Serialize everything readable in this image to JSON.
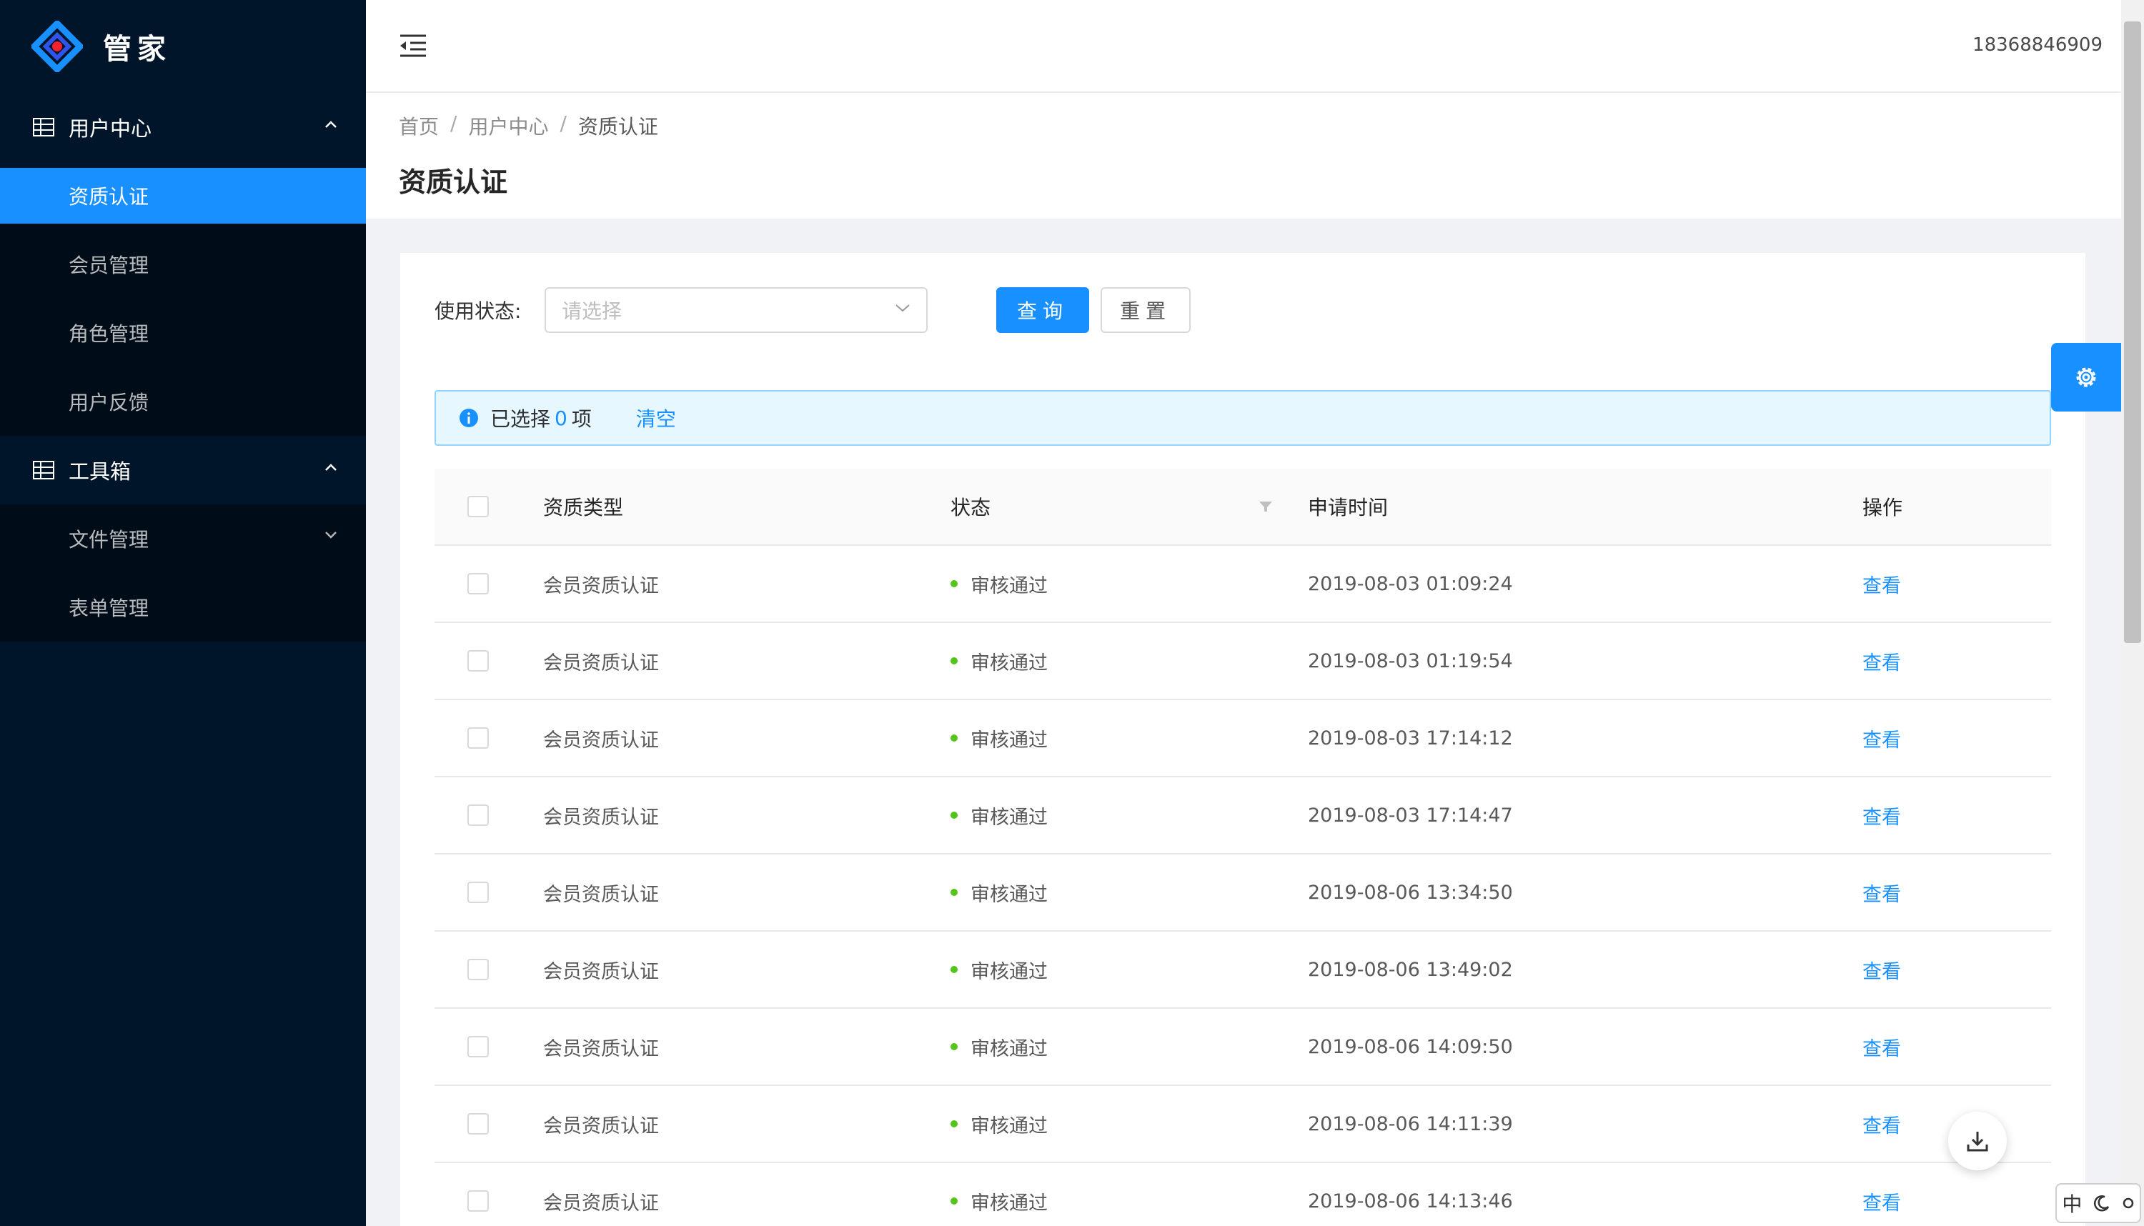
{
  "app": {
    "name": "管家"
  },
  "sidebar": {
    "groups": [
      {
        "label": "用户中心",
        "items": [
          "资质认证",
          "会员管理",
          "角色管理",
          "用户反馈"
        ]
      },
      {
        "label": "工具箱",
        "items": [
          "文件管理",
          "表单管理"
        ]
      }
    ]
  },
  "header": {
    "user_phone": "18368846909"
  },
  "breadcrumb": [
    "首页",
    "用户中心",
    "资质认证"
  ],
  "page_title": "资质认证",
  "filter": {
    "label": "使用状态:",
    "placeholder": "请选择",
    "query_label": "查询",
    "reset_label": "重置"
  },
  "alert": {
    "prefix": "已选择",
    "count": "0",
    "suffix": "项",
    "clear_label": "清空"
  },
  "table": {
    "columns": [
      "资质类型",
      "状态",
      "申请时间",
      "操作"
    ],
    "rows": [
      {
        "type": "会员资质认证",
        "status": "审核通过",
        "time": "2019-08-03 01:09:24",
        "action": "查看"
      },
      {
        "type": "会员资质认证",
        "status": "审核通过",
        "time": "2019-08-03 01:19:54",
        "action": "查看"
      },
      {
        "type": "会员资质认证",
        "status": "审核通过",
        "time": "2019-08-03 17:14:12",
        "action": "查看"
      },
      {
        "type": "会员资质认证",
        "status": "审核通过",
        "time": "2019-08-03 17:14:47",
        "action": "查看"
      },
      {
        "type": "会员资质认证",
        "status": "审核通过",
        "time": "2019-08-06 13:34:50",
        "action": "查看"
      },
      {
        "type": "会员资质认证",
        "status": "审核通过",
        "time": "2019-08-06 13:49:02",
        "action": "查看"
      },
      {
        "type": "会员资质认证",
        "status": "审核通过",
        "time": "2019-08-06 14:09:50",
        "action": "查看"
      },
      {
        "type": "会员资质认证",
        "status": "审核通过",
        "time": "2019-08-06 14:11:39",
        "action": "查看"
      },
      {
        "type": "会员资质认证",
        "status": "审核通过",
        "time": "2019-08-06 14:13:46",
        "action": "查看"
      }
    ]
  },
  "ime": {
    "mode": "中"
  },
  "colors": {
    "primary": "#1890ff",
    "sidebar": "#001529",
    "success": "#52c41a"
  }
}
